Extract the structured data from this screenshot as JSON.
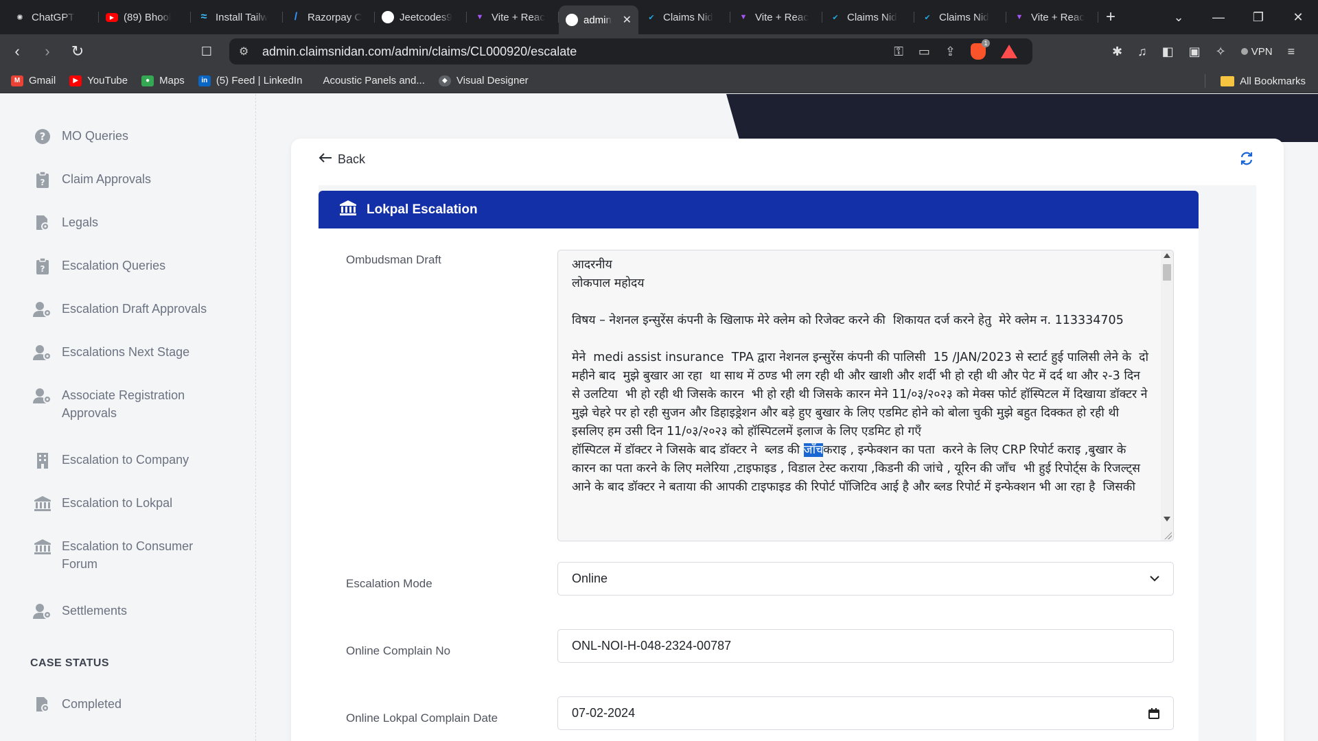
{
  "browser": {
    "tabs": [
      {
        "label": "ChatGPT",
        "icon": "chatgpt-icon",
        "color": "#1f2023"
      },
      {
        "label": "(89) Bhool",
        "icon": "youtube-icon",
        "color": "#ff0000"
      },
      {
        "label": "Install Tailw",
        "icon": "tailwind-icon",
        "color": "#38bdf8"
      },
      {
        "label": "Razorpay C",
        "icon": "razorpay-icon",
        "color": "#3395ff"
      },
      {
        "label": "Jeetcodes9",
        "icon": "github-icon",
        "color": "#ffffff"
      },
      {
        "label": "Vite + Reac",
        "icon": "vite-icon",
        "color": "#a855f7"
      },
      {
        "label": "admin",
        "icon": "admin-icon",
        "color": "#ffffff",
        "active": true
      },
      {
        "label": "Claims Nid",
        "icon": "claims-icon",
        "color": "#22a7e0"
      },
      {
        "label": "Vite + Reac",
        "icon": "vite-icon",
        "color": "#a855f7"
      },
      {
        "label": "Claims Nid",
        "icon": "claims-icon",
        "color": "#22a7e0"
      },
      {
        "label": "Claims Nid",
        "icon": "claims-icon",
        "color": "#22a7e0"
      },
      {
        "label": "Vite + Reac",
        "icon": "vite-icon",
        "color": "#a855f7"
      }
    ],
    "url": "admin.claimsnidan.com/admin/claims/CL000920/escalate",
    "vpn_label": "VPN",
    "bookmarks": [
      {
        "label": "Gmail",
        "color": "#ea4335",
        "letter": "M"
      },
      {
        "label": "YouTube",
        "color": "#ff0000",
        "letter": "▶"
      },
      {
        "label": "Maps",
        "color": "#34a853",
        "letter": "●"
      },
      {
        "label": "(5) Feed | LinkedIn",
        "color": "#0a66c2",
        "letter": "in"
      },
      {
        "label": "Acoustic Panels and...",
        "color": "#3a3b3f",
        "letter": ""
      },
      {
        "label": "Visual Designer",
        "color": "#5f6368",
        "letter": "◆"
      }
    ],
    "all_bookmarks": "All Bookmarks"
  },
  "sidebar": {
    "items": [
      {
        "label": "MO Queries",
        "icon": "question-circle-icon"
      },
      {
        "label": "Claim Approvals",
        "icon": "clipboard-question-icon"
      },
      {
        "label": "Legals",
        "icon": "file-gear-icon"
      },
      {
        "label": "Escalation Queries",
        "icon": "clipboard-question-icon"
      },
      {
        "label": "Escalation Draft Approvals",
        "icon": "user-gear-icon"
      },
      {
        "label": "Escalations Next Stage",
        "icon": "user-gear-icon"
      },
      {
        "label": "Associate Registration Approvals",
        "icon": "user-gear-icon"
      },
      {
        "label": "Escalation to Company",
        "icon": "building-icon"
      },
      {
        "label": "Escalation to Lokpal",
        "icon": "bank-icon"
      },
      {
        "label": "Escalation to Consumer Forum",
        "icon": "bank-icon"
      },
      {
        "label": "Settlements",
        "icon": "user-gear-icon"
      }
    ],
    "section_case_status": "CASE STATUS",
    "completed": "Completed"
  },
  "main": {
    "back_label": "Back",
    "banner_title": "Lokpal Escalation",
    "accent_color": "#1430a8",
    "form": {
      "ombudsman_label": "Ombudsman Draft",
      "ombudsman_before": "आदरनीय\nलोकपाल महोदय\n\nविषय – नेशनल इन्सुरेंस कंपनी के खिलाफ मेरे क्लेम को रिजेक्ट करने की  शिकायत दर्ज करने हेतु  मेरे क्लेम न. 113334705\n\nमेने  medi assist insurance  TPA द्वारा नेशनल इन्सुरेंस कंपनी की पालिसी  15 /JAN/2023 से स्टार्ट हुई पालिसी लेने के  दो महीने बाद  मुझे बुखार आ रहा  था साथ में ठण्ड भी लग रही थी और खाशी और शर्दी भी हो रही थी और पेट में दर्द था और २-3 दिन से उलटिया  भी हो रही थी जिसके कारन  भी हो रही थी जिसके कारन मेने 11/०३/२०२३ को मेक्स फोर्ट हॉस्पिटल में दिखाया डॉक्टर ने मुझे चेहरे पर हो रही सुजन और डिहाइड्रेशन और बड़े हुए बुखार के लिए एडमिट होने को बोला चुकी मुझे बहुत दिक्कत हो रही थी इसलिए हम उसी दिन 11/०३/२०२३ को हॉस्पिटलमें इलाज के लिए एडमिट हो गएँ\nहॉस्पिटल में डॉक्टर ने जिसके बाद डॉक्टर ने  ब्लड की ",
      "ombudsman_highlight": "जाँच",
      "ombudsman_after": "कराइ , इन्फेक्शन का पता  करने के लिए CRP रिपोर्ट कराइ ,बुखार के कारन का पता करने के लिए मलेरिया ,टाइफाइड , विडाल टेस्ट कराया ,किडनी की जांचे , यूरिन की जाँच  भी हुई रिपोर्ट्स के रिजल्ट्स आने के बाद डॉक्टर ने बताया की आपकी टाइफाइड की रिपोर्ट पॉजिटिव आई है और ब्लड रिपोर्ट में इन्फेक्शन भी आ रहा है  जिसकी ",
      "mode_label": "Escalation Mode",
      "mode_value": "Online",
      "complain_no_label": "Online Complain No",
      "complain_no_value": "ONL-NOI-H-048-2324-00787",
      "complain_date_label": "Online Lokpal Complain Date",
      "complain_date_value": "07-02-2024"
    }
  }
}
